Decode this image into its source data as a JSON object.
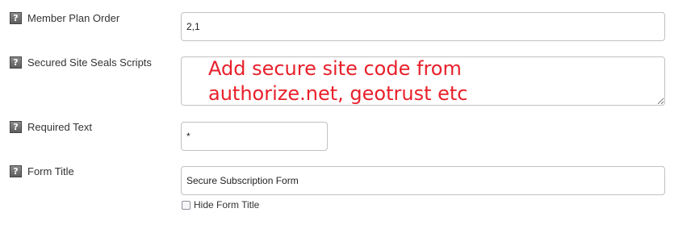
{
  "help_icon_glyph": "?",
  "rows": {
    "member_plan_order": {
      "label": "Member Plan Order",
      "value": "2,1"
    },
    "secured_site_seals": {
      "label": "Secured Site Seals Scripts",
      "value": "",
      "annotation": "Add secure site code from authorize.net, geotrust etc"
    },
    "required_text": {
      "label": "Required Text",
      "value": "*"
    },
    "form_title": {
      "label": "Form Title",
      "value": "Secure Subscription Form",
      "hide_checkbox_label": "Hide Form Title",
      "hide_checked": false
    }
  },
  "colors": {
    "annotation": "#e8202b",
    "input_border": "#c2c2c2",
    "label_text": "#333333"
  }
}
